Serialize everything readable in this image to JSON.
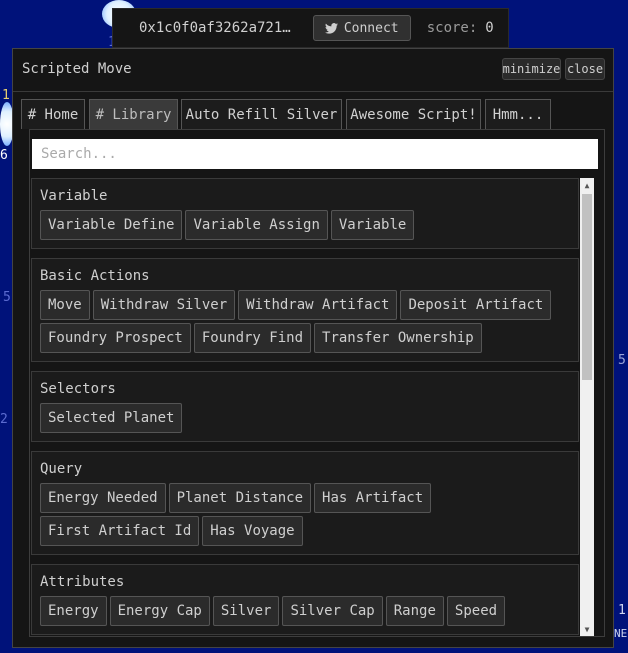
{
  "topbar": {
    "address": "0x1c0f0af3262a721…",
    "connect_label": "Connect",
    "score_label": "score:",
    "score_value": "0"
  },
  "panel": {
    "title": "Scripted Move",
    "minimize_label": "minimize",
    "close_label": "close",
    "tabs": [
      "# Home",
      "# Library",
      "Auto Refill Silver",
      "Awesome Script!",
      "Hmm..."
    ],
    "active_tab": "# Library",
    "search_placeholder": "Search..."
  },
  "sections": [
    {
      "title": "Variable",
      "buttons": [
        "Variable Define",
        "Variable Assign",
        "Variable"
      ]
    },
    {
      "title": "Basic Actions",
      "buttons": [
        "Move",
        "Withdraw Silver",
        "Withdraw Artifact",
        "Deposit Artifact",
        "Foundry Prospect",
        "Foundry Find",
        "Transfer Ownership"
      ]
    },
    {
      "title": "Selectors",
      "buttons": [
        "Selected Planet"
      ]
    },
    {
      "title": "Query",
      "buttons": [
        "Energy Needed",
        "Planet Distance",
        "Has Artifact",
        "First Artifact Id",
        "Has Voyage"
      ]
    },
    {
      "title": "Attributes",
      "buttons": [
        "Energy",
        "Energy Cap",
        "Silver",
        "Silver Cap",
        "Range",
        "Speed"
      ]
    }
  ],
  "background_labels": [
    "1",
    "1",
    "6",
    "5",
    "2",
    "5",
    "1",
    "NE"
  ],
  "icons": {
    "connect": "twitter-bird-icon",
    "scroll_up": "triangle-up-icon",
    "scroll_down": "triangle-down-icon"
  },
  "colors": {
    "background": "#00127a",
    "panel": "#151515",
    "search_bg": "#ffffff"
  }
}
